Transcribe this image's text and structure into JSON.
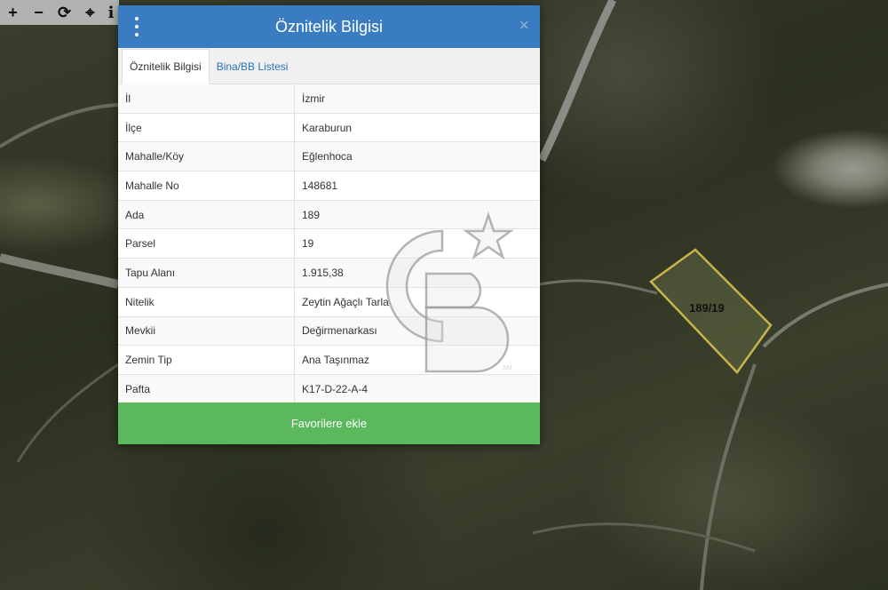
{
  "toolbar": {
    "tools": [
      {
        "name": "zoom-in",
        "glyph": "+"
      },
      {
        "name": "zoom-out",
        "glyph": "−"
      },
      {
        "name": "refresh",
        "glyph": "⟳"
      },
      {
        "name": "locate",
        "glyph": "⌖"
      },
      {
        "name": "info",
        "glyph": "i"
      }
    ]
  },
  "dialog": {
    "title": "Öznitelik Bilgisi",
    "close_glyph": "×",
    "tabs": [
      {
        "label": "Öznitelik Bilgisi"
      },
      {
        "label": "Bina/BB Listesi"
      }
    ],
    "rows": [
      {
        "key": "İl",
        "value": "İzmir"
      },
      {
        "key": "İlçe",
        "value": "Karaburun"
      },
      {
        "key": "Mahalle/Köy",
        "value": "Eğlenhoca"
      },
      {
        "key": "Mahalle No",
        "value": "148681"
      },
      {
        "key": "Ada",
        "value": "189"
      },
      {
        "key": "Parsel",
        "value": "19"
      },
      {
        "key": "Tapu Alanı",
        "value": "1.915,38"
      },
      {
        "key": "Nitelik",
        "value": "Zeytin Ağaçlı Tarla"
      },
      {
        "key": "Mevkii",
        "value": "Değirmenarkası"
      },
      {
        "key": "Zemin Tip",
        "value": "Ana Taşınmaz"
      },
      {
        "key": "Pafta",
        "value": "K17-D-22-A-4"
      }
    ],
    "favorite_label": "Favorilere ekle"
  },
  "map": {
    "parcel_label": "189/19",
    "parcel_color": "#c8b44a"
  },
  "watermark": {
    "text": "CB",
    "mark": "SM"
  },
  "colors": {
    "header": "#3a7cc1",
    "favorite": "#5cb85c",
    "tab_link": "#2b73b8"
  }
}
